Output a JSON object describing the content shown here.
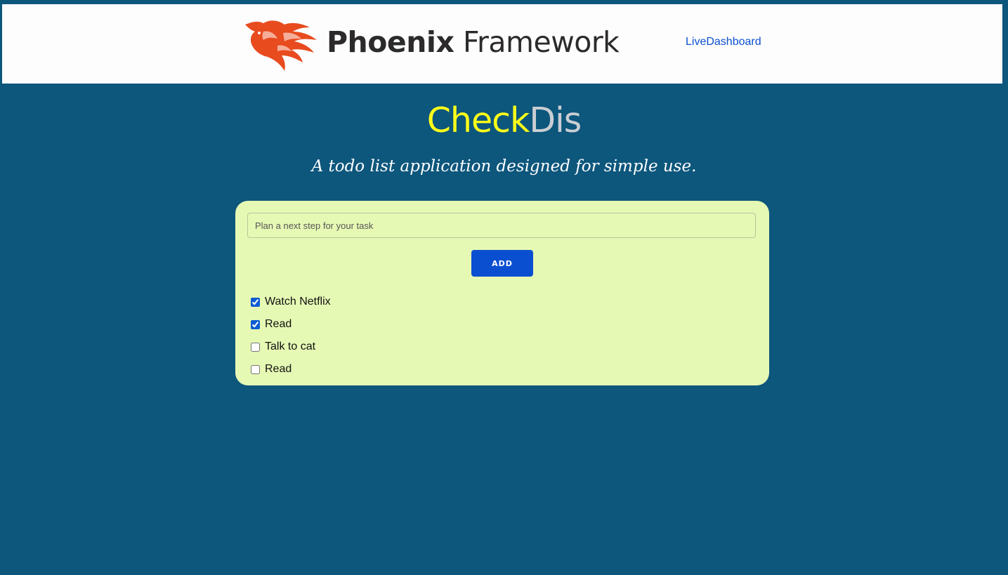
{
  "header": {
    "logo_text_bold": "Phoenix",
    "logo_text_regular": "Framework",
    "nav_link": "LiveDashboard"
  },
  "app": {
    "title_part1": "Check",
    "title_part2": "Dis",
    "tagline": "A todo list application designed for simple use."
  },
  "form": {
    "input_placeholder": "Plan a next step for your task",
    "input_value": "",
    "add_label": "ADD"
  },
  "todos": [
    {
      "label": "Watch Netflix",
      "done": true
    },
    {
      "label": "Read",
      "done": true
    },
    {
      "label": "Talk to cat",
      "done": false
    },
    {
      "label": "Read",
      "done": false
    }
  ],
  "colors": {
    "page_bg": "#0d567c",
    "card_bg": "#e6f9b4",
    "accent": "#0b4fd1",
    "title_check": "#ffff19",
    "title_dis": "#c9ced3",
    "phoenix_orange": "#e84b1e"
  },
  "icons": {
    "logo": "phoenix-bird-icon"
  }
}
